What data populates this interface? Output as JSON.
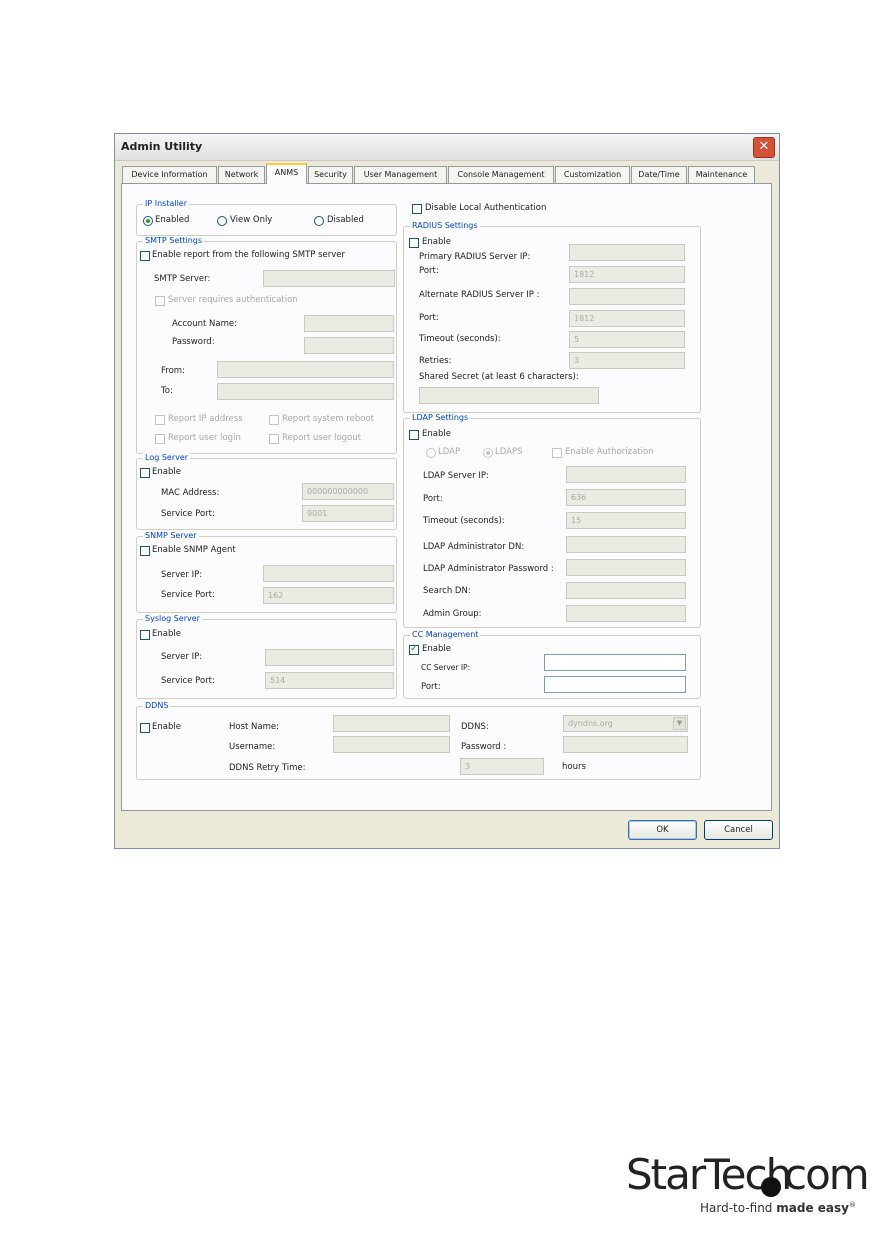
{
  "window": {
    "title": "Admin Utility",
    "close_glyph": "✕"
  },
  "tabs": [
    {
      "label": "Device Information"
    },
    {
      "label": "Network"
    },
    {
      "label": "ANMS",
      "active": true
    },
    {
      "label": "Security"
    },
    {
      "label": "User Management"
    },
    {
      "label": "Console Management"
    },
    {
      "label": "Customization"
    },
    {
      "label": "Date/Time"
    },
    {
      "label": "Maintenance"
    }
  ],
  "ip_installer": {
    "legend": "IP Installer",
    "options": [
      "Enabled",
      "View Only",
      "Disabled"
    ],
    "selected": "Enabled"
  },
  "smtp": {
    "legend": "SMTP Settings",
    "enable_label": "Enable report from the following SMTP server",
    "server_label": "SMTP Server:",
    "auth_label": "Server requires authentication",
    "account_label": "Account Name:",
    "password_label": "Password:",
    "from_label": "From:",
    "to_label": "To:",
    "report_ip": "Report IP address",
    "report_reboot": "Report system reboot",
    "report_login": "Report user login",
    "report_logout": "Report user logout"
  },
  "log_server": {
    "legend": "Log Server",
    "enable_label": "Enable",
    "mac_label": "MAC Address:",
    "mac_value": "000000000000",
    "port_label": "Service Port:",
    "port_value": "9001"
  },
  "snmp": {
    "legend": "SNMP Server",
    "enable_label": "Enable SNMP Agent",
    "ip_label": "Server IP:",
    "port_label": "Service Port:",
    "port_value": "162"
  },
  "syslog": {
    "legend": "Syslog Server",
    "enable_label": "Enable",
    "ip_label": "Server IP:",
    "port_label": "Service Port:",
    "port_value": "514"
  },
  "disable_local_auth": "Disable Local Authentication",
  "radius": {
    "legend": "RADIUS Settings",
    "enable_label": "Enable",
    "primary_ip_label": "Primary RADIUS Server IP:",
    "port_label": "Port:",
    "port_value": "1812",
    "alt_ip_label": "Alternate RADIUS Server IP :",
    "alt_port_label": "Port:",
    "alt_port_value": "1812",
    "timeout_label": "Timeout (seconds):",
    "timeout_value": "5",
    "retries_label": "Retries:",
    "retries_value": "3",
    "secret_label": "Shared Secret (at least 6 characters):"
  },
  "ldap": {
    "legend": "LDAP Settings",
    "enable_label": "Enable",
    "ldap_option": "LDAP",
    "ldaps_option": "LDAPS",
    "enable_auth_label": "Enable Authorization",
    "server_ip_label": "LDAP Server IP:",
    "port_label": "Port:",
    "port_value": "636",
    "timeout_label": "Timeout (seconds):",
    "timeout_value": "15",
    "admin_dn_label": "LDAP Administrator DN:",
    "admin_pw_label": "LDAP Administrator Password :",
    "search_dn_label": "Search DN:",
    "admin_group_label": "Admin Group:"
  },
  "cc": {
    "legend": "CC Management",
    "enable_label": "Enable",
    "server_ip_label": "CC Server IP:",
    "port_label": "Port:"
  },
  "ddns": {
    "legend": "DDNS",
    "enable_label": "Enable",
    "host_label": "Host Name:",
    "username_label": "Username:",
    "retry_label": "DDNS Retry Time:",
    "retry_value": "3",
    "retry_unit": "hours",
    "ddns_label": "DDNS:",
    "ddns_value": "dyndns.org",
    "password_label": "Password :"
  },
  "buttons": {
    "ok": "OK",
    "cancel": "Cancel"
  },
  "logo": {
    "brand": "StarTech",
    "suffix": "com",
    "tagline_plain": "Hard-to-find ",
    "tagline_bold": "made easy",
    "reg": "®"
  }
}
